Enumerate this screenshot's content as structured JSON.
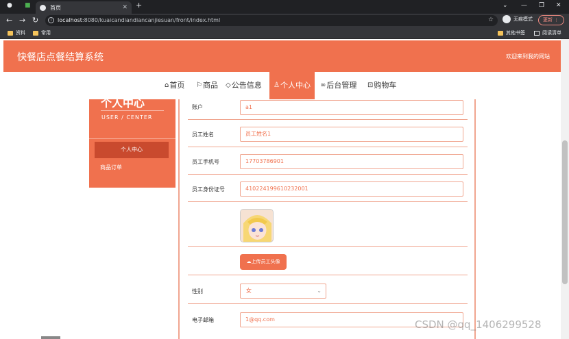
{
  "browser": {
    "tab_title": "首页",
    "url_host": "localhost",
    "url_rest": ":8080/kuaicandiandiancanjiesuan/front/index.html",
    "incognito_label": "无痕模式",
    "update_label": "更新",
    "bookmarks": [
      "资料",
      "常用"
    ],
    "bookmarks_right": [
      "其他书签",
      "阅读清单"
    ]
  },
  "header": {
    "site_title": "快餐店点餐结算系统",
    "welcome": "欢迎来到我的网站"
  },
  "nav": {
    "items": [
      "首页",
      "商品",
      "公告信息",
      "个人中心",
      "后台管理",
      "购物车"
    ],
    "active": "个人中心"
  },
  "sidebar": {
    "title": "个人中心",
    "subtitle": "USER / CENTER",
    "active_item": "个人中心",
    "link_item": "商品订单"
  },
  "form": {
    "account_label": "账户",
    "account_value": "a1",
    "name_label": "员工姓名",
    "name_value": "员工姓名1",
    "phone_label": "员工手机号",
    "phone_value": "17703786901",
    "id_label": "员工身份证号",
    "id_value": "410224199610232001",
    "upload_label": "上传员工头像",
    "gender_label": "性别",
    "gender_value": "女",
    "email_label": "电子邮箱",
    "email_value": "1@qq.com"
  },
  "watermark": "CSDN @qq_1406299528",
  "colors": {
    "brand": "#f0714e",
    "brand_dark": "#c94a2e",
    "border": "#f0a58f"
  }
}
